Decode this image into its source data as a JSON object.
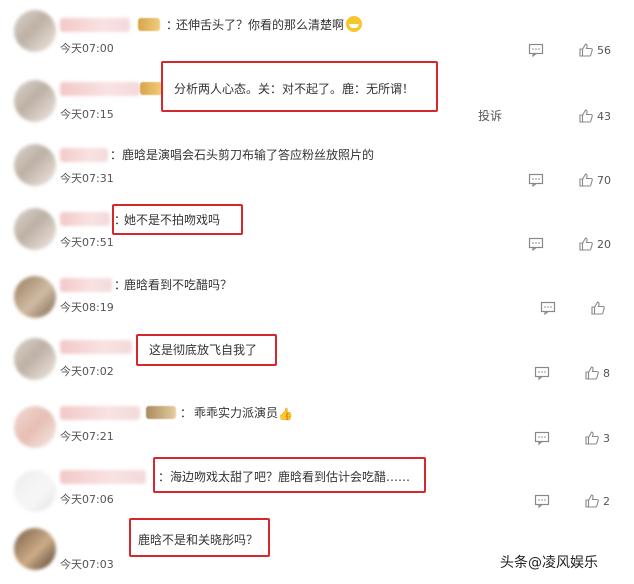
{
  "comments": [
    {
      "text": "还伸舌头了？你看的那么清楚啊",
      "time": "今天07:00",
      "likes": "56",
      "emoji": "grin-emoji"
    },
    {
      "text": "分析两人心态。关：对不起了。鹿：无所谓！",
      "time": "今天07:15",
      "likes": "43"
    },
    {
      "text": "鹿晗是演唱会石头剪刀布输了答应粉丝放照片的",
      "time": "今天07:31",
      "likes": "70"
    },
    {
      "text": "她不是不拍吻戏吗",
      "time": "今天07:51",
      "likes": "20"
    },
    {
      "text": "鹿晗看到不吃醋吗？",
      "time": "今天08:19",
      "likes": ""
    },
    {
      "text": "这是彻底放飞自我了",
      "time": "今天07:02",
      "likes": "8"
    },
    {
      "text": "乖乖实力派演员",
      "time": "今天07:21",
      "likes": "3",
      "emoji": "thumbs-up-emoji"
    },
    {
      "text": "海边吻戏太甜了吧？鹿晗看到估计会吃醋……",
      "time": "今天07:06",
      "likes": "2"
    },
    {
      "text": "鹿晗不是和关晓彤吗？",
      "time": "今天07:03",
      "likes": ""
    }
  ],
  "report_label": "投诉",
  "watermark": "头条@凌风娱乐",
  "colors": {
    "highlight": "#d6272d",
    "icon": "#888888"
  }
}
